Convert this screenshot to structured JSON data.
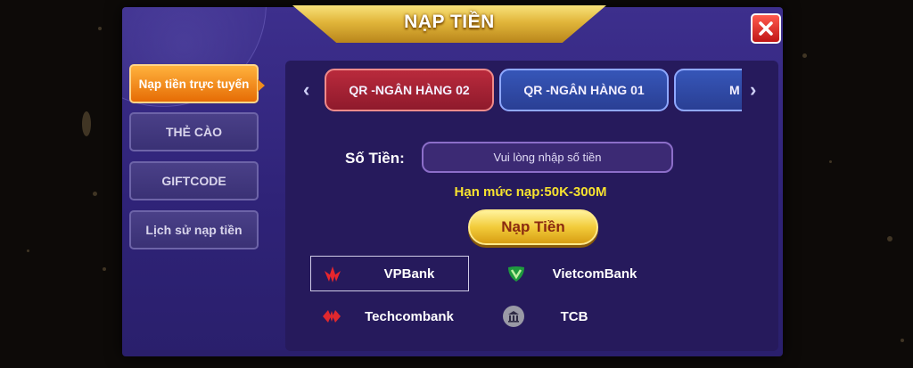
{
  "dialog": {
    "title": "NẠP TIỀN",
    "close_icon": "close-icon"
  },
  "sidebar": {
    "items": [
      {
        "label": "Nạp tiền trực tuyến",
        "active": true
      },
      {
        "label": "THẺ CÀO",
        "active": false
      },
      {
        "label": "GIFTCODE",
        "active": false
      },
      {
        "label": "Lịch sử nạp tiền",
        "active": false
      }
    ]
  },
  "bank_tabs": {
    "prev_arrow": "‹",
    "next_arrow": "›",
    "items": [
      {
        "label": "QR -NGÂN HÀNG 02",
        "selected": true
      },
      {
        "label": "QR -NGÂN HÀNG 01",
        "selected": false
      },
      {
        "label": "M",
        "selected": false
      }
    ]
  },
  "form": {
    "amount_label": "Số Tiền:",
    "amount_value": "",
    "amount_placeholder": "Vui lòng nhập số tiền",
    "limit_text": "Hạn mức nạp:50K-300M",
    "deposit_button": "Nạp Tiền"
  },
  "banks": [
    {
      "name": "VPBank",
      "icon": "vpbank-logo-icon",
      "selected": true
    },
    {
      "name": "VietcomBank",
      "icon": "vietcombank-logo-icon",
      "selected": false
    },
    {
      "name": "Techcombank",
      "icon": "techcombank-logo-icon",
      "selected": false
    },
    {
      "name": "TCB",
      "icon": "bank-building-icon",
      "selected": false
    }
  ],
  "colors": {
    "dialog_bg": "#2f2378",
    "active_tab": "#e66c05",
    "selected_bank_tab": "#b92a3c",
    "bank_tab": "#2a3f94",
    "limit_text": "#f7e22f",
    "gold": "#f2cb3a"
  }
}
